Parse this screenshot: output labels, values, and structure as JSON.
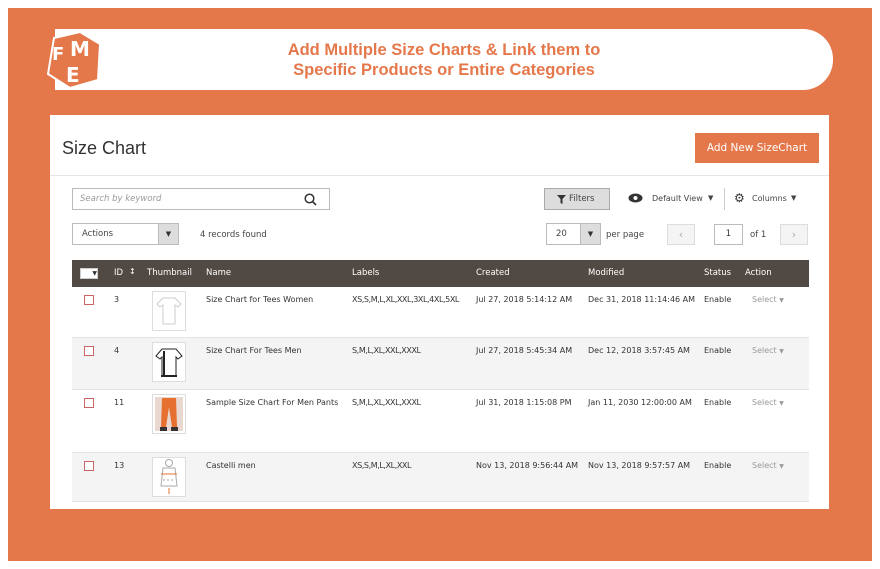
{
  "banner": {
    "line1": "Add Multiple Size Charts & Link them to",
    "line2": "Specific Products or Entire Categories",
    "logo": "FME"
  },
  "page": {
    "title": "Size Chart",
    "add_button": "Add New SizeChart"
  },
  "toolbar": {
    "search_placeholder": "Search by keyword",
    "filters": "Filters",
    "default_view": "Default View",
    "columns": "Columns",
    "actions": "Actions",
    "records": "4 records found",
    "per_page_value": "20",
    "per_page_label": "per page",
    "page": "1",
    "of_pages": "of 1"
  },
  "columns": [
    "ID",
    "Thumbnail",
    "Name",
    "Labels",
    "Created",
    "Modified",
    "Status",
    "Action"
  ],
  "rows": [
    {
      "id": "3",
      "name": "Size Chart for Tees Women",
      "labels": "XS,S,M,L,XL,XXL,3XL,4XL,5XL",
      "created": "Jul 27, 2018 5:14:12 AM",
      "modified": "Dec 31, 2018 11:14:46 AM",
      "status": "Enable",
      "action": "Select",
      "thumb": "tee-women"
    },
    {
      "id": "4",
      "name": "Size Chart For Tees Men",
      "labels": "S,M,L,XL,XXL,XXXL",
      "created": "Jul 27, 2018 5:45:34 AM",
      "modified": "Dec 12, 2018 3:57:45 AM",
      "status": "Enable",
      "action": "Select",
      "thumb": "tee-men"
    },
    {
      "id": "11",
      "name": "Sample Size Chart For Men Pants",
      "labels": "S,M,L,XL,XXL,XXXL",
      "created": "Jul 31, 2018 1:15:08 PM",
      "modified": "Jan 11, 2030 12:00:00 AM",
      "status": "Enable",
      "action": "Select",
      "thumb": "pants"
    },
    {
      "id": "13",
      "name": "Castelli men",
      "labels": "XS,S,M,L,XL,XXL",
      "created": "Nov 13, 2018 9:56:44 AM",
      "modified": "Nov 13, 2018 9:57:57 AM",
      "status": "Enable",
      "action": "Select",
      "thumb": "body"
    }
  ],
  "colors": {
    "brand": "#e5784b",
    "header": "#514943"
  }
}
